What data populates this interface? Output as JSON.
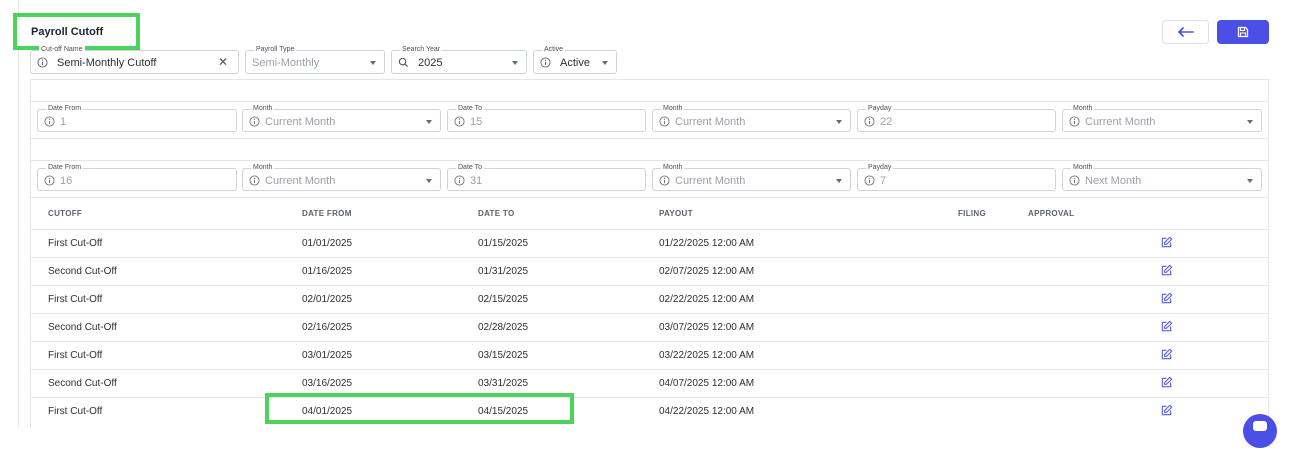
{
  "title": "Payroll Cutoff",
  "actions": {
    "back_icon": "arrow-left-icon",
    "save_icon": "save-icon"
  },
  "filters": {
    "cutoff_name": {
      "label": "Cut-off Name",
      "value": "Semi-Monthly Cutoff"
    },
    "payroll_type": {
      "label": "Payroll Type",
      "value": "Semi-Monthly"
    },
    "search_year": {
      "label": "Search Year",
      "value": "2025"
    },
    "active": {
      "label": "Active",
      "value": "Active"
    }
  },
  "first_cutoff": {
    "date_from": {
      "label": "Date From",
      "value": "1"
    },
    "date_from_month": {
      "label": "Month",
      "value": "Current Month"
    },
    "date_to": {
      "label": "Date To",
      "value": "15"
    },
    "date_to_month": {
      "label": "Month",
      "value": "Current Month"
    },
    "payday": {
      "label": "Payday",
      "value": "22"
    },
    "payday_month": {
      "label": "Month",
      "value": "Current Month"
    }
  },
  "second_cutoff": {
    "date_from": {
      "label": "Date From",
      "value": "16"
    },
    "date_from_month": {
      "label": "Month",
      "value": "Current Month"
    },
    "date_to": {
      "label": "Date To",
      "value": "31"
    },
    "date_to_month": {
      "label": "Month",
      "value": "Current Month"
    },
    "payday": {
      "label": "Payday",
      "value": "7"
    },
    "payday_month": {
      "label": "Month",
      "value": "Next Month"
    }
  },
  "table": {
    "headers": {
      "cutoff": "CUTOFF",
      "date_from": "DATE FROM",
      "date_to": "DATE TO",
      "payout": "PAYOUT",
      "filing": "FILING",
      "approval": "APPROVAL"
    },
    "rows": [
      {
        "cutoff": "First Cut-Off",
        "date_from": "01/01/2025",
        "date_to": "01/15/2025",
        "payout": "01/22/2025 12:00 AM"
      },
      {
        "cutoff": "Second Cut-Off",
        "date_from": "01/16/2025",
        "date_to": "01/31/2025",
        "payout": "02/07/2025 12:00 AM"
      },
      {
        "cutoff": "First Cut-Off",
        "date_from": "02/01/2025",
        "date_to": "02/15/2025",
        "payout": "02/22/2025 12:00 AM"
      },
      {
        "cutoff": "Second Cut-Off",
        "date_from": "02/16/2025",
        "date_to": "02/28/2025",
        "payout": "03/07/2025 12:00 AM"
      },
      {
        "cutoff": "First Cut-Off",
        "date_from": "03/01/2025",
        "date_to": "03/15/2025",
        "payout": "03/22/2025 12:00 AM"
      },
      {
        "cutoff": "Second Cut-Off",
        "date_from": "03/16/2025",
        "date_to": "03/31/2025",
        "payout": "04/07/2025 12:00 AM"
      },
      {
        "cutoff": "First Cut-Off",
        "date_from": "04/01/2025",
        "date_to": "04/15/2025",
        "payout": "04/22/2025 12:00 AM"
      }
    ]
  },
  "colors": {
    "accent": "#4b4fe6",
    "highlight": "#4cd35c"
  }
}
